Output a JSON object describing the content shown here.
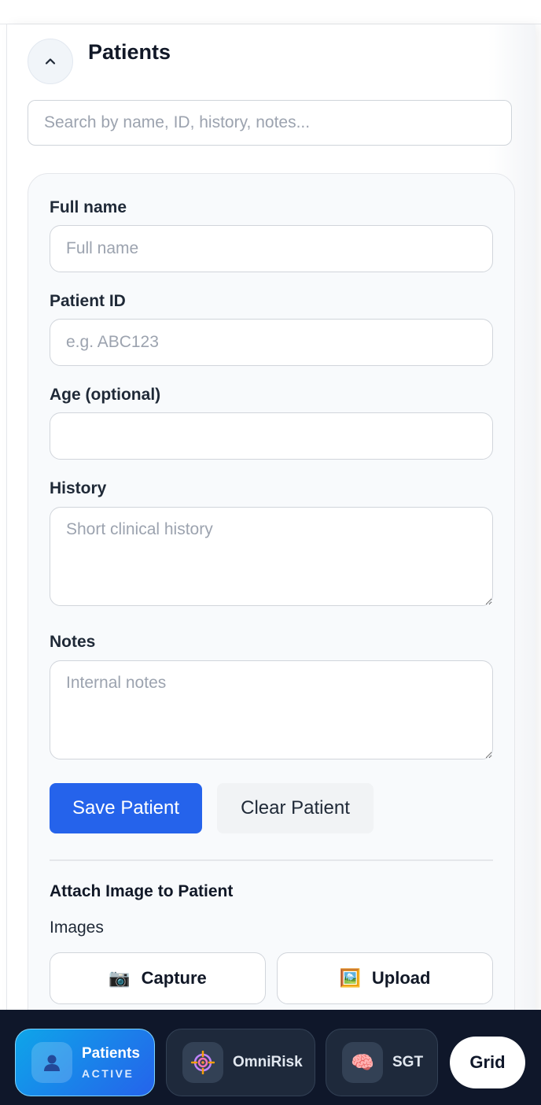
{
  "panel": {
    "title": "Patients"
  },
  "search": {
    "placeholder": "Search by name, ID, history, notes..."
  },
  "form": {
    "full_name": {
      "label": "Full name",
      "placeholder": "Full name",
      "value": ""
    },
    "patient_id": {
      "label": "Patient ID",
      "placeholder": "e.g. ABC123",
      "value": ""
    },
    "age": {
      "label": "Age (optional)",
      "placeholder": "",
      "value": ""
    },
    "history": {
      "label": "History",
      "placeholder": "Short clinical history",
      "value": ""
    },
    "notes": {
      "label": "Notes",
      "placeholder": "Internal notes",
      "value": ""
    },
    "save_label": "Save Patient",
    "clear_label": "Clear Patient"
  },
  "attach": {
    "heading": "Attach Image to Patient",
    "images_label": "Images",
    "capture_icon": "📷",
    "capture_label": "Capture",
    "upload_icon": "🖼️",
    "upload_label": "Upload"
  },
  "nav": {
    "patients": {
      "label": "Patients",
      "status": "ACTIVE",
      "icon": "user-icon"
    },
    "omnirisk": {
      "label": "OmniRisk",
      "icon": "target-icon"
    },
    "sgt": {
      "label": "SGT",
      "icon": "🧠"
    },
    "grid": {
      "label": "Grid"
    }
  },
  "colors": {
    "primary": "#2563eb",
    "nav_background": "#0f172a",
    "active_gradient_start": "#0ea5e9"
  }
}
